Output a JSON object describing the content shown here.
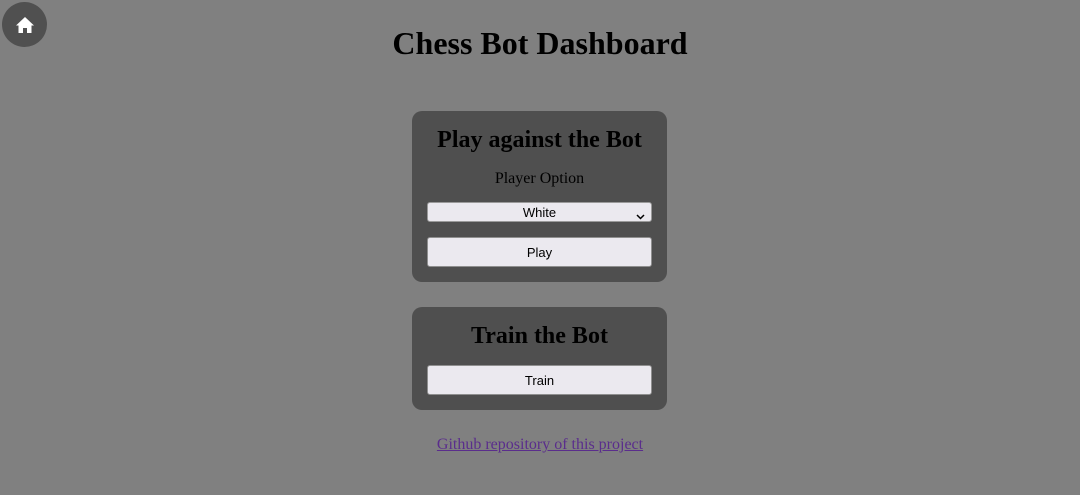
{
  "header": {
    "home_icon": "home-icon",
    "title": "Chess Bot Dashboard"
  },
  "play_card": {
    "title": "Play against the Bot",
    "player_option_label": "Player Option",
    "player_select_value": "White",
    "play_button_label": "Play"
  },
  "train_card": {
    "title": "Train the Bot",
    "train_button_label": "Train"
  },
  "footer": {
    "repo_link_text": "Github repository of this project"
  },
  "colors": {
    "background": "#808080",
    "card_background": "#4f4f4f",
    "home_button": "#505050",
    "link": "#5a2d8c"
  }
}
